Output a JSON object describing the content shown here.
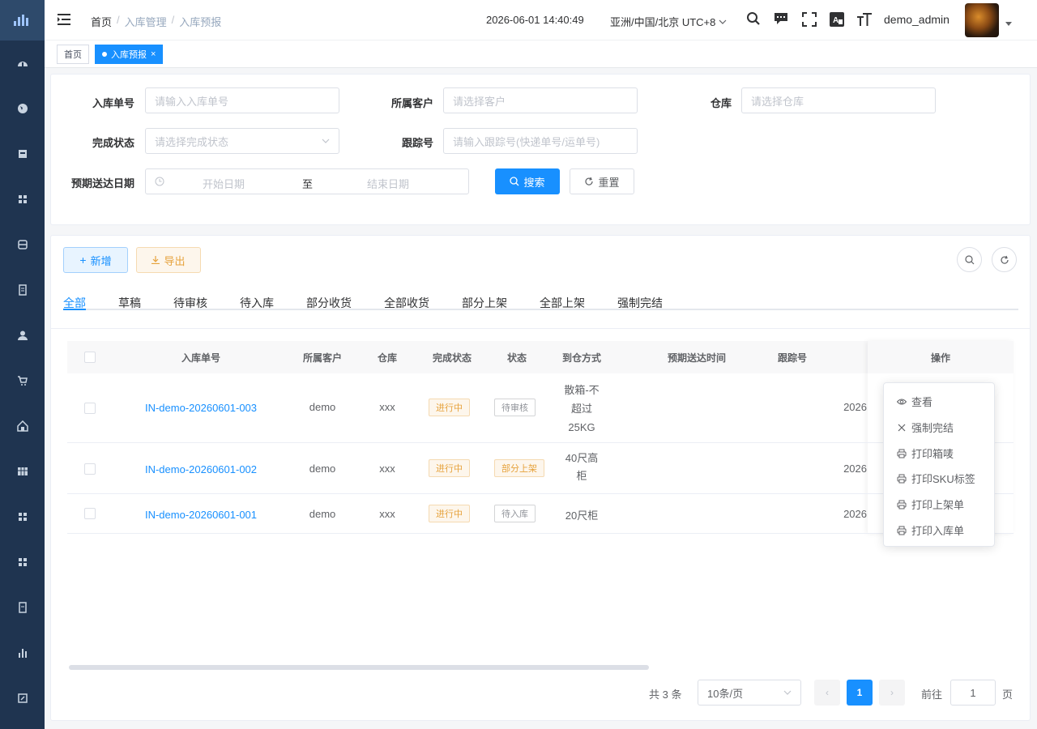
{
  "header": {
    "breadcrumb": [
      "首页",
      "入库管理",
      "入库预报"
    ],
    "separator": "/",
    "datetime": "2026-06-01 14:40:49",
    "timezone": "亚洲/中国/北京 UTC+8",
    "username": "demo_admin"
  },
  "tags": [
    {
      "label": "首页"
    },
    {
      "label": "入库预报",
      "close": "×"
    }
  ],
  "search": {
    "order_no_label": "入库单号",
    "order_no_placeholder": "请输入入库单号",
    "customer_label": "所属客户",
    "customer_placeholder": "请选择客户",
    "warehouse_label": "仓库",
    "warehouse_placeholder": "请选择仓库",
    "status_label": "完成状态",
    "status_placeholder": "请选择完成状态",
    "tracking_label": "跟踪号",
    "tracking_placeholder": "请输入跟踪号(快递单号/运单号)",
    "date_label": "预期送达日期",
    "date_start": "开始日期",
    "date_sep": "至",
    "date_end": "结束日期",
    "search_btn": "搜索",
    "reset_btn": "重置"
  },
  "toolbar": {
    "add": "新增",
    "export": "导出"
  },
  "tabs": [
    "全部",
    "草稿",
    "待审核",
    "待入库",
    "部分收货",
    "全部收货",
    "部分上架",
    "全部上架",
    "强制完结"
  ],
  "table": {
    "headers": [
      "入库单号",
      "所属客户",
      "仓库",
      "完成状态",
      "状态",
      "到仓方式",
      "预期送达时间",
      "跟踪号",
      "操作"
    ],
    "rows": [
      {
        "order_no": "IN-demo-20260601-003",
        "customer": "demo",
        "warehouse": "xxx",
        "completion": "进行中",
        "status": "待审核",
        "arrival_lines": [
          "散箱-不",
          "超过",
          "25KG"
        ],
        "date": "2026"
      },
      {
        "order_no": "IN-demo-20260601-002",
        "customer": "demo",
        "warehouse": "xxx",
        "completion": "进行中",
        "status": "部分上架",
        "arrival_lines": [
          "40尺高",
          "柜"
        ],
        "date": "2026"
      },
      {
        "order_no": "IN-demo-20260601-001",
        "customer": "demo",
        "warehouse": "xxx",
        "completion": "进行中",
        "status": "待入库",
        "arrival_lines": [
          "20尺柜"
        ],
        "date": "2026"
      }
    ]
  },
  "action_menu": [
    "查看",
    "强制完结",
    "打印箱唛",
    "打印SKU标签",
    "打印上架单",
    "打印入库单"
  ],
  "pagination": {
    "total": "共 3 条",
    "page_size": "10条/页",
    "current": "1",
    "goto_label": "前往",
    "goto_value": "1",
    "page_suffix": "页"
  },
  "colors": {
    "primary": "#1890ff",
    "sidebar": "#1f3450",
    "warning": "#e6a23c"
  }
}
